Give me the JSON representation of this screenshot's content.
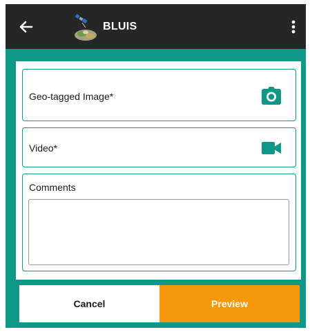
{
  "appbar": {
    "title": "BLUIS",
    "back_icon": "arrow-left-icon",
    "logo_icon": "satellite-logo-icon",
    "menu_icon": "more-vertical-icon"
  },
  "form": {
    "geo_image_label": "Geo-tagged Image*",
    "geo_image_icon": "camera-icon",
    "video_label": "Video*",
    "video_icon": "video-camera-icon",
    "comments_label": "Comments",
    "comments_value": ""
  },
  "actions": {
    "cancel_label": "Cancel",
    "preview_label": "Preview"
  },
  "colors": {
    "primary": "#0f9888",
    "appbar": "#262626",
    "accent": "#f7980b"
  }
}
